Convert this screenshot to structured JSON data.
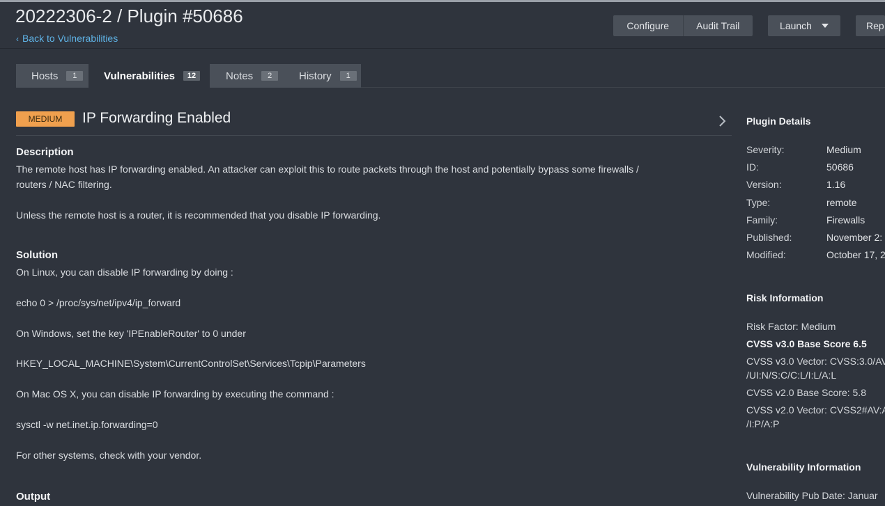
{
  "header": {
    "title": "20222306-2 / Plugin #50686",
    "back_link": "Back to Vulnerabilities",
    "buttons": {
      "configure": "Configure",
      "audit_trail": "Audit Trail",
      "launch": "Launch",
      "report": "Rep"
    }
  },
  "tabs": [
    {
      "label": "Hosts",
      "count": "1"
    },
    {
      "label": "Vulnerabilities",
      "count": "12"
    },
    {
      "label": "Notes",
      "count": "2"
    },
    {
      "label": "History",
      "count": "1"
    }
  ],
  "vulnerability": {
    "severity": "MEDIUM",
    "title": "IP Forwarding Enabled",
    "description_heading": "Description",
    "description": [
      "The remote host has IP forwarding enabled. An attacker can exploit this to route packets through the host and potentially bypass some firewalls /",
      "routers / NAC filtering.",
      "Unless the remote host is a router, it is recommended that you disable IP forwarding."
    ],
    "solution_heading": "Solution",
    "solution": [
      "On Linux, you can disable IP forwarding by doing :",
      "echo 0 > /proc/sys/net/ipv4/ip_forward",
      "On Windows, set the key 'IPEnableRouter' to 0 under",
      "HKEY_LOCAL_MACHINE\\System\\CurrentControlSet\\Services\\Tcpip\\Parameters",
      "On Mac OS X, you can disable IP forwarding by executing the command :",
      "sysctl -w net.inet.ip.forwarding=0",
      "For other systems, check with your vendor."
    ],
    "output_heading": "Output"
  },
  "sidebar": {
    "plugin_details": {
      "heading": "Plugin Details",
      "rows": [
        {
          "label": "Severity:",
          "value": "Medium"
        },
        {
          "label": "ID:",
          "value": "50686"
        },
        {
          "label": "Version:",
          "value": "1.16"
        },
        {
          "label": "Type:",
          "value": "remote"
        },
        {
          "label": "Family:",
          "value": "Firewalls"
        },
        {
          "label": "Published:",
          "value": "November 2:"
        },
        {
          "label": "Modified:",
          "value": "October 17, 2"
        }
      ]
    },
    "risk_information": {
      "heading": "Risk Information",
      "risk_factor": "Risk Factor: Medium",
      "cvss3_base": "CVSS v3.0 Base Score 6.5",
      "cvss3_vector_1": "CVSS v3.0 Vector: CVSS:3.0/AV:",
      "cvss3_vector_2": "/UI:N/S:C/C:L/I:L/A:L",
      "cvss2_base": "CVSS v2.0 Base Score: 5.8",
      "cvss2_vector_1": "CVSS v2.0 Vector: CVSS2#AV:A",
      "cvss2_vector_2": "/I:P/A:P"
    },
    "vulnerability_information": {
      "heading": "Vulnerability Information",
      "pub_date": "Vulnerability Pub Date: Januar"
    }
  },
  "colors": {
    "background": "#2f343d",
    "link": "#5fb3e6",
    "severity_medium": "#f0a04e",
    "button": "#4a5059"
  }
}
